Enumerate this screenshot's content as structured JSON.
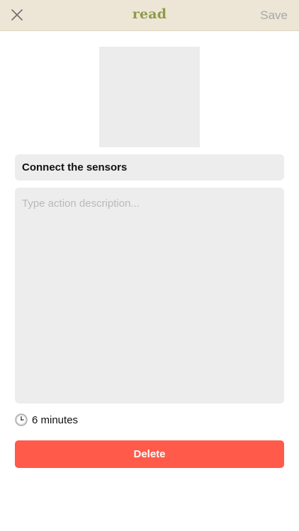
{
  "header": {
    "brand": "read",
    "save_label": "Save",
    "close_icon": "close-icon"
  },
  "action": {
    "image_placeholder": "image-placeholder",
    "title_value": "Connect the sensors",
    "description_value": "",
    "description_placeholder": "Type action description...",
    "duration_icon": "clock-icon",
    "duration_label": "6 minutes"
  },
  "footer": {
    "delete_label": "Delete"
  },
  "colors": {
    "header_bg": "#ede6d6",
    "brand": "#8f9a4a",
    "save_disabled": "#a8a8a8",
    "field_bg": "#ededed",
    "delete_bg": "#ff5a4a"
  }
}
